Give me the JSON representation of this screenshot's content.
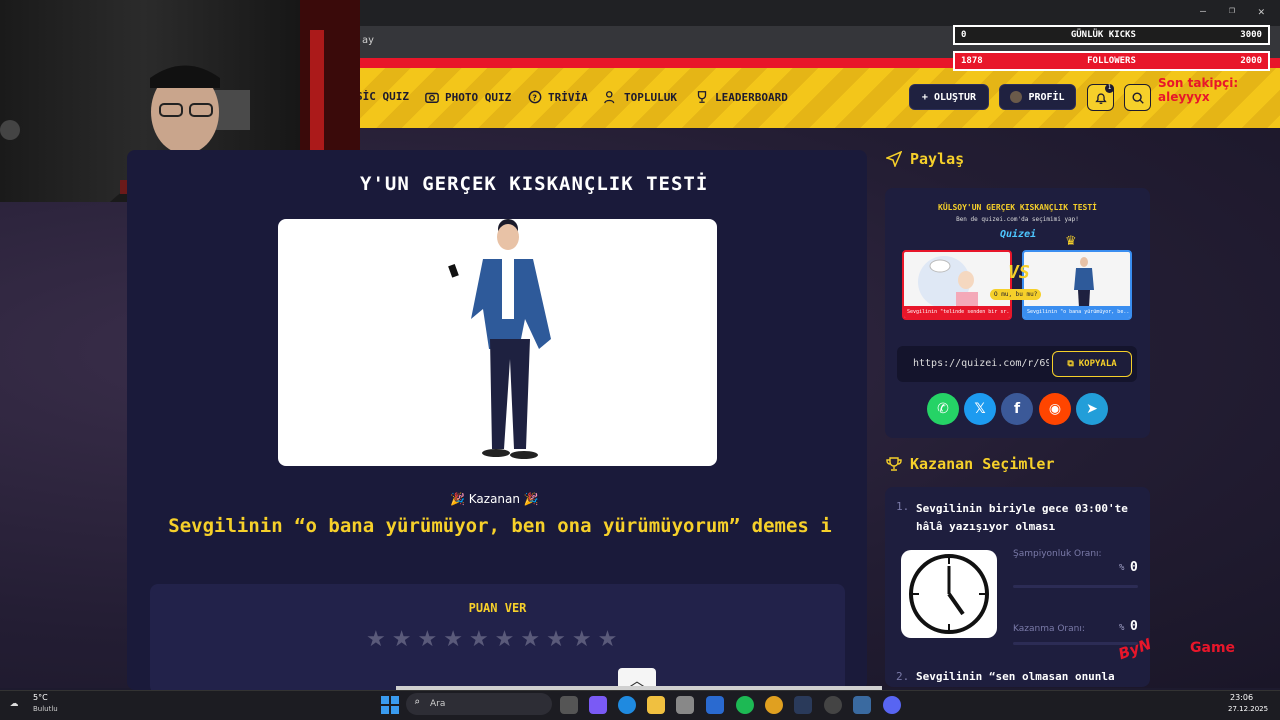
{
  "browser": {
    "address_fragment": "ay"
  },
  "nav": {
    "items": [
      {
        "label": "SİC QUIZ",
        "icon": "music-icon"
      },
      {
        "label": "PHOTO QUIZ",
        "icon": "camera-icon"
      },
      {
        "label": "TRİVİA",
        "icon": "question-icon"
      },
      {
        "label": "TOPLULUK",
        "icon": "users-icon"
      },
      {
        "label": "LEADERBOARD",
        "icon": "trophy-icon"
      }
    ],
    "create_label": "OLUŞTUR",
    "profile_label": "PROFİL",
    "notif_count": "1"
  },
  "stream": {
    "kicks_value": "0",
    "kicks_label": "GÜNLÜK KICKS",
    "kicks_goal": "3000",
    "followers_value": "1878",
    "followers_label": "FOLLOWERS",
    "followers_goal": "2000",
    "last_follower": "Son takipçi: aleyyyx",
    "watermark_a": "ByN",
    "watermark_b": "Game"
  },
  "quiz": {
    "title": "Y'UN GERÇEK KISKANÇLIK TESTİ",
    "winner_label": "🎉 Kazanan 🎉",
    "winner_text": "Sevgilinin “o bana yürümüyor, ben ona yürümüyorum” demes i",
    "rate_title": "PUAN VER",
    "stars": [
      "★",
      "★",
      "★",
      "★",
      "★",
      "★",
      "★",
      "★",
      "★",
      "★"
    ]
  },
  "share": {
    "title": "Paylaş",
    "preview_title": "KÜLSOY'UN GERÇEK KISKANÇLIK TESTİ",
    "preview_sub": "Ben de quizei.com'da seçimimi yap!",
    "brand": "Quizei",
    "vs": "VS",
    "ormu": "O mu, bu mu?",
    "caption_left": "Sevgilinin \"telinde senden bir sr...",
    "caption_right": "Sevgilinin \"o bana yürümüyor, be...",
    "url": "https://quizei.com/r/69!",
    "copy_label": "KOPYALA",
    "socials": [
      {
        "name": "whatsapp-icon",
        "color": "#25d366",
        "glyph": "✆"
      },
      {
        "name": "x-icon",
        "color": "#1d9bf0",
        "glyph": "𝕏"
      },
      {
        "name": "facebook-icon",
        "color": "#3b5998",
        "glyph": "f"
      },
      {
        "name": "reddit-icon",
        "color": "#ff4500",
        "glyph": "◉"
      },
      {
        "name": "telegram-icon",
        "color": "#229ed9",
        "glyph": "➤"
      }
    ]
  },
  "winners": {
    "title": "Kazanan Seçimler",
    "item1_num": "1.",
    "item1_text": "Sevgilinin biriyle gece 03:00'te hâlâ yazışıyor olması",
    "champ_label": "Şampiyonluk Oranı:",
    "champ_pct": "%",
    "champ_value": "0",
    "win_label": "Kazanma Oranı:",
    "win_pct": "%",
    "win_value": "0",
    "item2_num": "2.",
    "item2_text": "Sevgilinin “sen olmasan onunla"
  },
  "taskbar": {
    "temp": "5°C",
    "weather": "Bulutlu",
    "search": "Ara",
    "time": "23:06",
    "date": "27.12.2025"
  }
}
